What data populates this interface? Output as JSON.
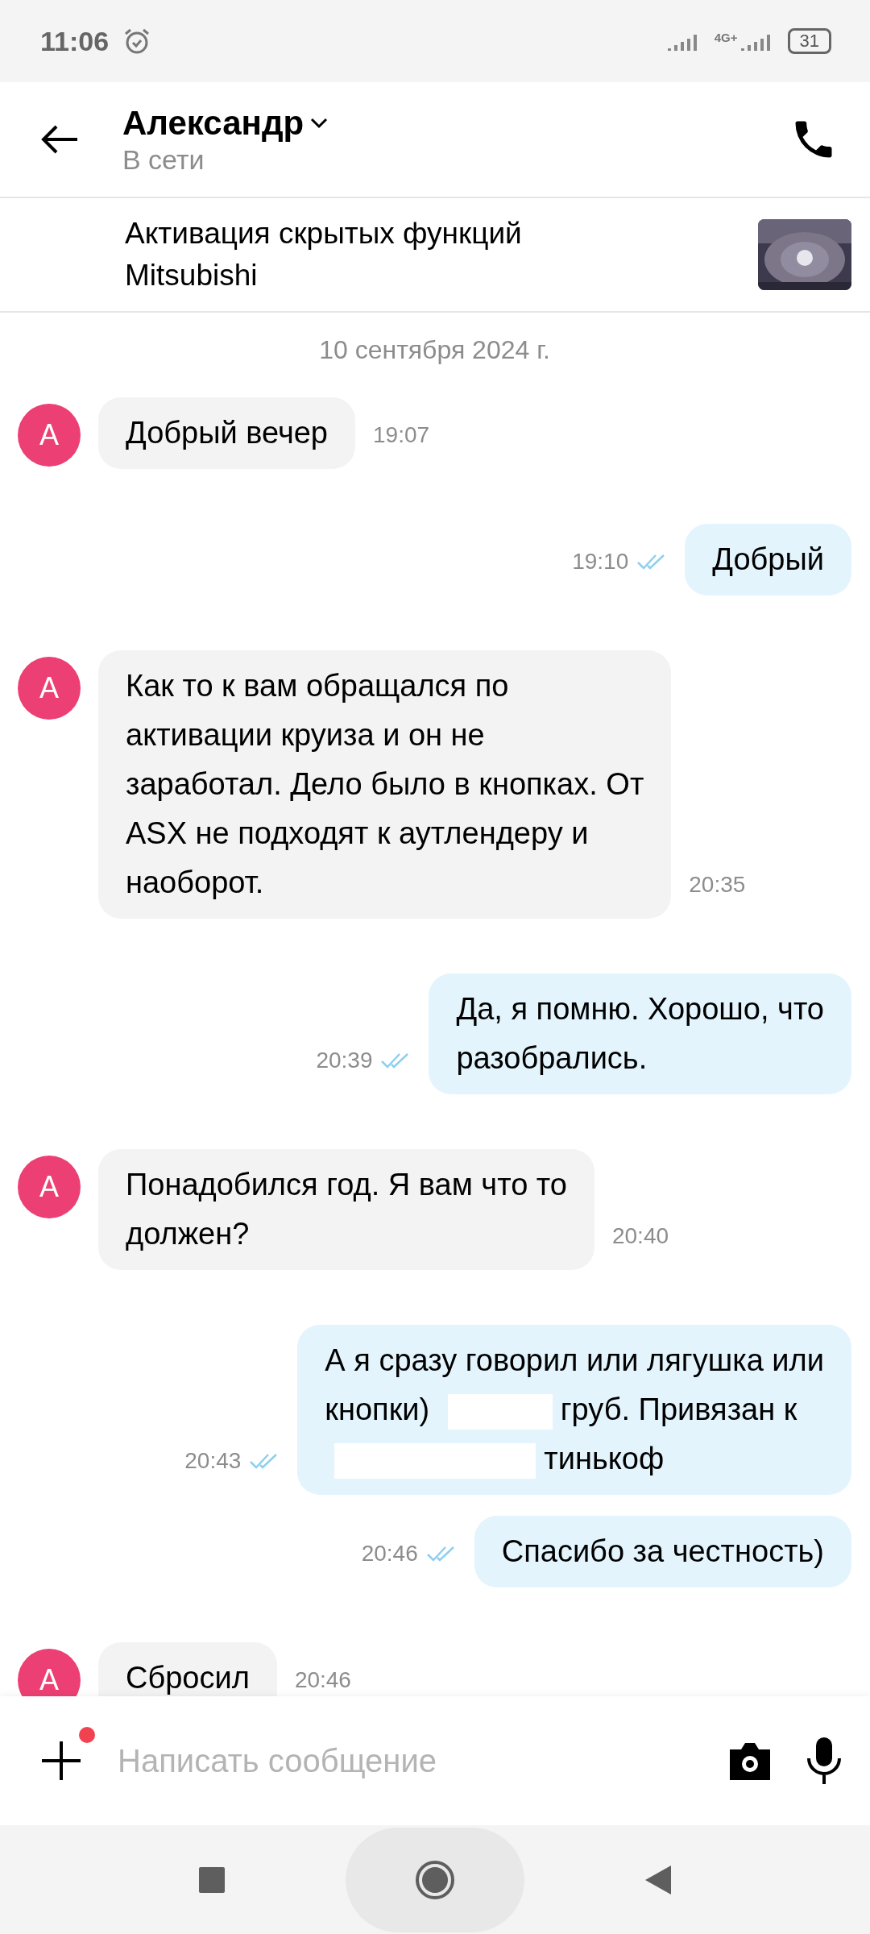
{
  "status_bar": {
    "time": "11:06",
    "network": "4G+",
    "battery": "31"
  },
  "header": {
    "name": "Александр",
    "status": "В сети"
  },
  "listing": {
    "title": "Активация скрытых функций Mitsubishi"
  },
  "date": "10 сентября 2024 г.",
  "messages": [
    {
      "kind": "incoming",
      "avatar": "А",
      "parts": [
        {
          "kind": "text",
          "text": "Добрый вечер"
        }
      ],
      "time": "19:07"
    },
    {
      "kind": "outgoing",
      "read": true,
      "parts": [
        {
          "kind": "text",
          "text": "Добрый"
        }
      ],
      "time": "19:10"
    },
    {
      "kind": "incoming",
      "avatar": "А",
      "parts": [
        {
          "kind": "text",
          "text": "Как то к вам обращался по\nактивации круиза и он не\nзаработал. Дело было в кнопках. От\nASX не подходят к аутлендеру и\nнаоборот."
        }
      ],
      "time": "20:35"
    },
    {
      "kind": "outgoing",
      "read": true,
      "parts": [
        {
          "kind": "text",
          "text": "Да, я помню. Хорошо, что\nразобрались."
        }
      ],
      "time": "20:39"
    },
    {
      "kind": "incoming",
      "avatar": "А",
      "parts": [
        {
          "kind": "text",
          "text": "Понадобился год. Я вам что то\nдолжен?"
        }
      ],
      "time": "20:40"
    },
    {
      "kind": "outgoing",
      "read": true,
      "parts": [
        {
          "kind": "text",
          "text": "А я сразу говорил или лягушка или\nкнопки)"
        },
        {
          "kind": "redacted_short"
        },
        {
          "kind": "text",
          "text": "груб. Привязан к\n"
        },
        {
          "kind": "redacted_long"
        },
        {
          "kind": "text",
          "text": "тинькоф"
        }
      ],
      "time": "20:43"
    },
    {
      "kind": "outgoing",
      "read": true,
      "parts": [
        {
          "kind": "text",
          "text": "Спасибо за честность)"
        }
      ],
      "time": "20:46"
    },
    {
      "kind": "incoming",
      "avatar": "А",
      "parts": [
        {
          "kind": "text",
          "text": "Сбросил"
        }
      ],
      "time": "20:46"
    }
  ],
  "composer": {
    "placeholder": "Написать сообщение",
    "attach_badge": true
  }
}
